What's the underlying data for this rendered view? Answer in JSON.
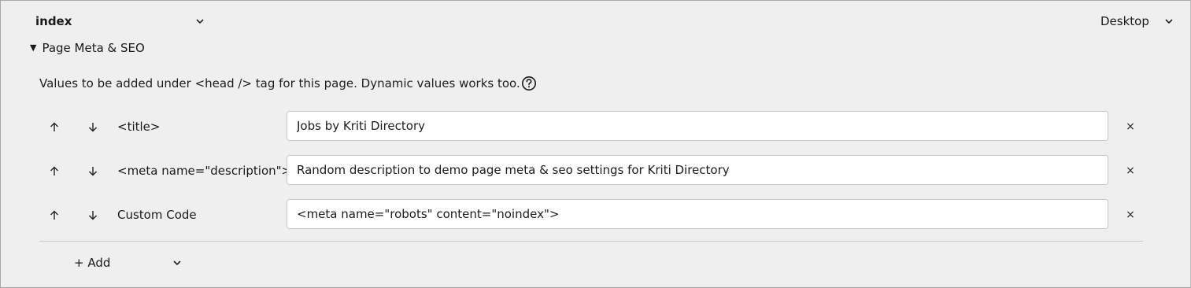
{
  "header": {
    "page_select": "index",
    "device_select": "Desktop"
  },
  "section": {
    "toggle_icon": "▼",
    "title": "Page Meta & SEO",
    "hint": "Values to be added under <head /> tag for this page. Dynamic values works too."
  },
  "rows": [
    {
      "label": "<title>",
      "value": "Jobs by Kriti Directory"
    },
    {
      "label": "<meta name=\"description\">",
      "value": "Random description to demo page meta & seo settings for Kriti Directory"
    },
    {
      "label": "Custom Code",
      "value": "<meta name=\"robots\" content=\"noindex\">"
    }
  ],
  "row_controls": {
    "up_icon": "↑",
    "down_icon": "↓",
    "remove_icon": "×"
  },
  "add": {
    "label": "+ Add"
  },
  "icons": {
    "page_chevron": "chevron-down-icon",
    "device_chevron": "chevron-down-icon",
    "help": "help-circle-icon",
    "add_chevron": "chevron-down-icon"
  }
}
